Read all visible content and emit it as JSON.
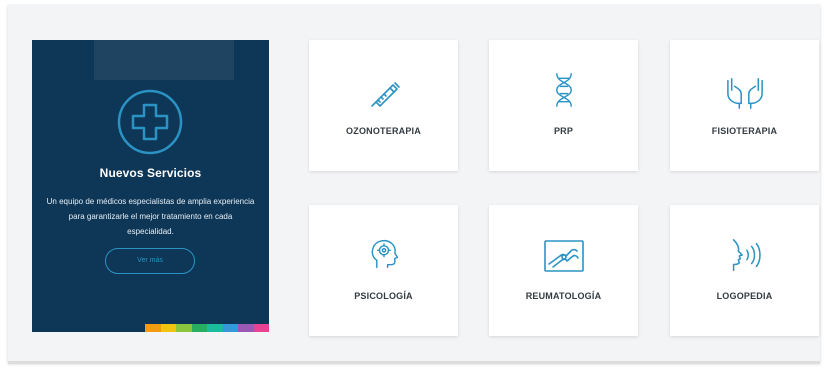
{
  "colors": {
    "promo_bg": "#0e3656",
    "accent": "#2b93c4",
    "tile_bg": "#ffffff",
    "page_bg": "#f3f4f5"
  },
  "promo": {
    "icon": "plus-cross-icon",
    "title": "Nuevos Servicios",
    "description": "Un equipo de médicos especialistas de amplia experiencia para garantizarle el mejor tratamiento en cada especialidad.",
    "button_label": "Ver más",
    "color_stripes": [
      "#f39c12",
      "#f1c40f",
      "#8cc63f",
      "#27ae60",
      "#1abc9c",
      "#3498db",
      "#9b59b6",
      "#e84393"
    ]
  },
  "services": [
    {
      "label": "OZONOTERAPIA",
      "icon": "syringe-icon"
    },
    {
      "label": "PRP",
      "icon": "dna-icon"
    },
    {
      "label": "FISIOTERAPIA",
      "icon": "hands-icon"
    },
    {
      "label": "PSICOLOGÍA",
      "icon": "head-gear-icon"
    },
    {
      "label": "REUMATOLOGÍA",
      "icon": "xray-joint-icon"
    },
    {
      "label": "LOGOPEDIA",
      "icon": "speech-face-icon"
    }
  ]
}
